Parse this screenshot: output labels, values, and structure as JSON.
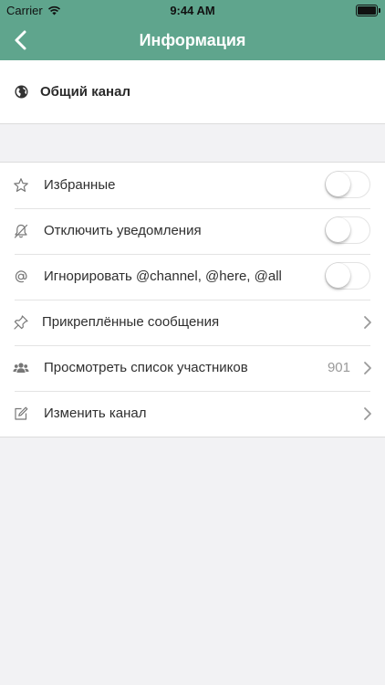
{
  "status_bar": {
    "carrier": "Carrier",
    "time": "9:44 AM"
  },
  "nav": {
    "title": "Информация"
  },
  "channel": {
    "name": "Общий канал"
  },
  "settings": [
    {
      "label": "Избранные",
      "icon": "star-icon",
      "type": "toggle",
      "on": false
    },
    {
      "label": "Отключить уведомления",
      "icon": "bell-off-icon",
      "type": "toggle",
      "on": false
    },
    {
      "label": "Игнорировать @channel, @here, @all",
      "icon": "at-sign-icon",
      "type": "toggle",
      "on": false
    },
    {
      "label": "Прикреплённые сообщения",
      "icon": "pin-icon",
      "type": "link"
    },
    {
      "label": "Просмотреть список участников",
      "icon": "users-icon",
      "type": "link",
      "count": "901"
    },
    {
      "label": "Изменить канал",
      "icon": "edit-icon",
      "type": "link"
    }
  ],
  "colors": {
    "accent": "#5fa58d",
    "background": "#f2f2f4"
  }
}
